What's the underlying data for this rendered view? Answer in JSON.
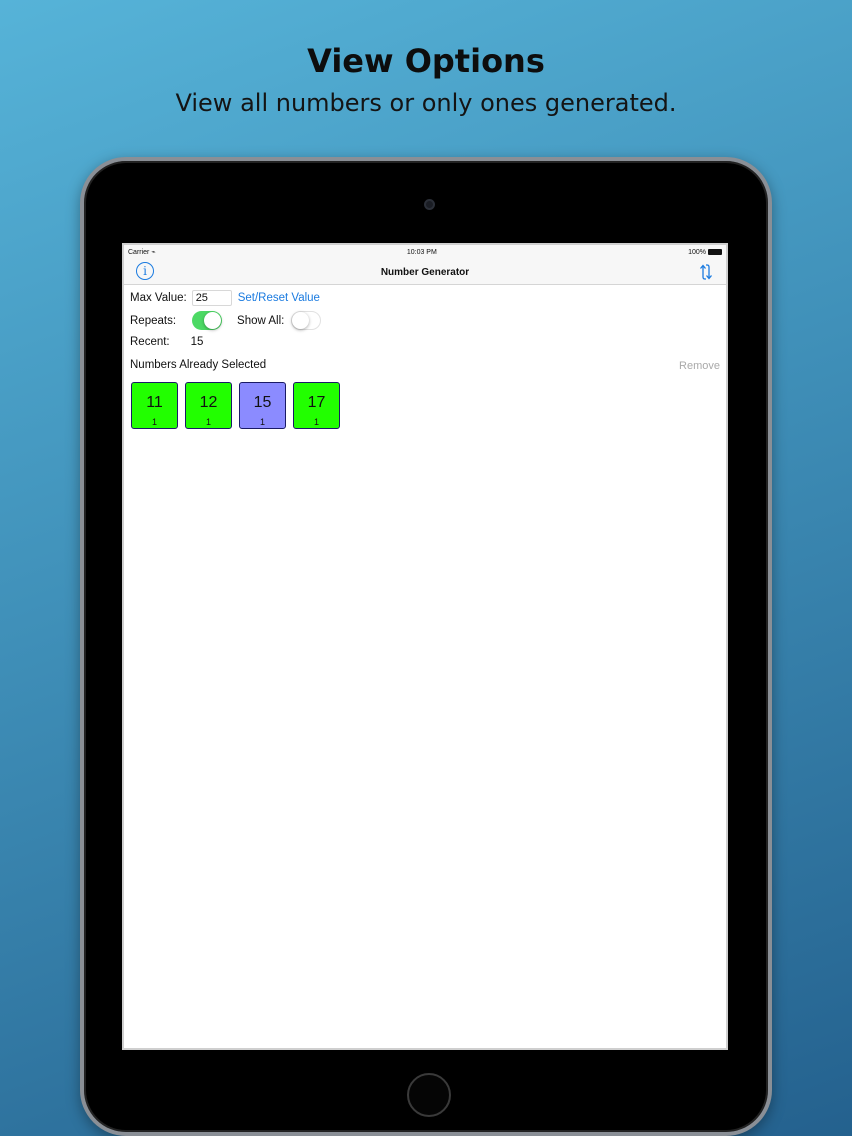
{
  "promo": {
    "title": "View Options",
    "subtitle": "View all numbers or only ones generated."
  },
  "status_bar": {
    "carrier": "Carrier",
    "time": "10:03 PM",
    "battery": "100%"
  },
  "nav": {
    "title": "Number Generator",
    "info_icon": "info-icon",
    "reset_icon": "reset-arrows-icon"
  },
  "controls": {
    "max_label": "Max Value:",
    "max_value": "25",
    "set_reset_label": "Set/Reset Value",
    "repeats_label": "Repeats:",
    "repeats_on": true,
    "show_all_label": "Show All:",
    "show_all_on": false,
    "recent_label": "Recent:",
    "recent_value": "15"
  },
  "selected": {
    "heading": "Numbers Already Selected",
    "remove_label": "Remove",
    "tiles": [
      {
        "number": "11",
        "count": "1",
        "color": "#22ff00"
      },
      {
        "number": "12",
        "count": "1",
        "color": "#22ff00"
      },
      {
        "number": "15",
        "count": "1",
        "color": "#8b8bff"
      },
      {
        "number": "17",
        "count": "1",
        "color": "#22ff00"
      }
    ]
  },
  "colors": {
    "accent": "#1b7be0",
    "toggle_on": "#4cd964"
  }
}
